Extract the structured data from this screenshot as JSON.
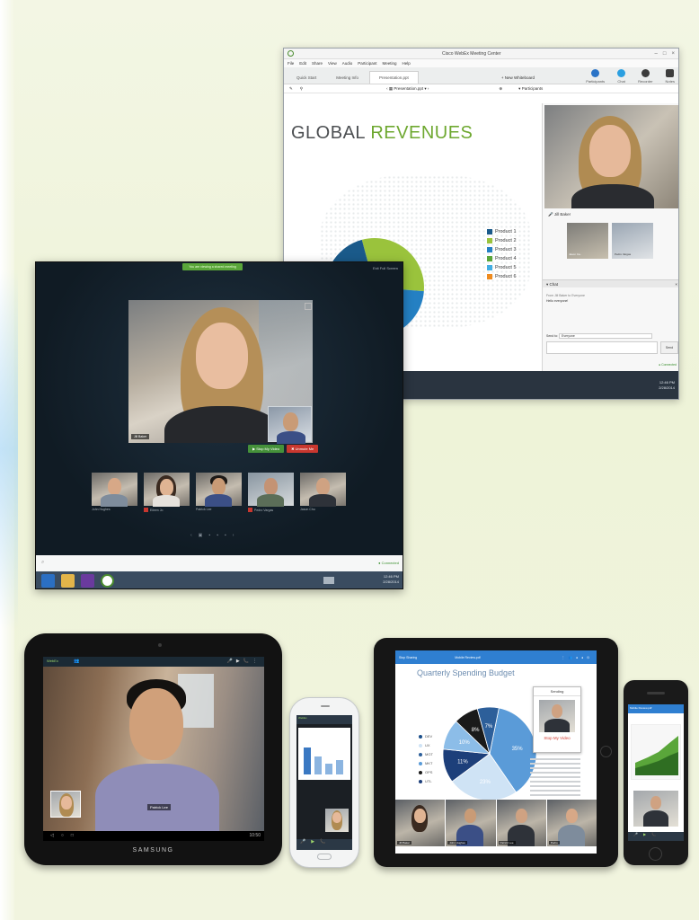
{
  "desktop_window_back": {
    "title": "Cisco WebEx Meeting Center",
    "menu": [
      "File",
      "Edit",
      "Share",
      "View",
      "Audio",
      "Participant",
      "Meeting",
      "Help"
    ],
    "tabs": [
      "Quick Start",
      "Meeting Info",
      "Presentation.ppt"
    ],
    "tools": [
      {
        "label": "Participants",
        "icon": "participants-icon",
        "color": "#2b74c7"
      },
      {
        "label": "Chat",
        "icon": "chat-icon",
        "color": "#2b9fe0"
      },
      {
        "label": "Recorder",
        "icon": "recorder-icon",
        "color": "#3c3c3c"
      },
      {
        "label": "Notes",
        "icon": "notes-icon",
        "color": "#3c3c3c"
      }
    ],
    "new_whiteboard": "New Whiteboard",
    "file_name": "Presentation.ppt",
    "slide_title_part1": "GLOBAL ",
    "slide_title_part2": "REVENUES",
    "legend": [
      {
        "label": "Product 1",
        "color": "#1a5a8a"
      },
      {
        "label": "Product 2",
        "color": "#9ac33c"
      },
      {
        "label": "Product 3",
        "color": "#2480c3"
      },
      {
        "label": "Product 4",
        "color": "#5aa63a"
      },
      {
        "label": "Product 5",
        "color": "#43aee3"
      },
      {
        "label": "Product 6",
        "color": "#ef8b1e"
      }
    ],
    "participants_header": "Participants",
    "speaker_name": "Jill Baker",
    "thumb_names": [
      "Jason Ca..",
      "Pedro Vargas"
    ],
    "chat_header": "Chat",
    "chat_from": "From Jill Baker to Everyone",
    "chat_msg": "Hello everyone!",
    "send_to_label": "Send to:",
    "send_to_value": "Everyone",
    "send_button": "Send",
    "connected": "Connected",
    "clock_time": "12:46 PM",
    "clock_date": "2/28/2014"
  },
  "desktop_window_front": {
    "top_pill": "You are viewing a shared meeting",
    "full_screen": "Exit Full Screen",
    "stage_name": "Jill Baker",
    "stop_video": "Stop My Video",
    "unmute": "Unmute Me",
    "thumbnails": [
      {
        "name": "John Hughes",
        "muted": false
      },
      {
        "name": "Eileen Jo",
        "muted": true
      },
      {
        "name": "Patrick Lee",
        "muted": false
      },
      {
        "name": "Pedro Vargas",
        "muted": true
      },
      {
        "name": "Jason Chu",
        "muted": false
      }
    ],
    "pager": [
      "‹",
      "▣",
      "▪",
      "▪",
      "▪",
      "›"
    ],
    "connected": "Connected",
    "clock_time": "12:46 PM",
    "clock_date": "2/28/2014"
  },
  "tablet": {
    "brand": "SAMSUNG",
    "caller_name": "Patrick Lee",
    "status_time": "10:50",
    "app_label": "WebEx"
  },
  "phone1": {
    "app_label": "WebEx"
  },
  "ipad": {
    "header_left": "Stop Sharing",
    "header_file": "Mobile Review.pdf",
    "title": "Quarterly Spending Budget",
    "legend": [
      {
        "label": "DEV",
        "color": "#1a4e8a"
      },
      {
        "label": "UX",
        "color": "#cfe3f5"
      },
      {
        "label": "MGT",
        "color": "#2d5f9a"
      },
      {
        "label": "MKT",
        "color": "#5a9bd8"
      },
      {
        "label": "OPS",
        "color": "#1a1a1a"
      },
      {
        "label": "UTL",
        "color": "#1d3f7a"
      }
    ],
    "pie": [
      {
        "label": "35%",
        "value": 35,
        "color": "#5a9bd8"
      },
      {
        "label": "23%",
        "value": 23,
        "color": "#cfe3f5"
      },
      {
        "label": "11%",
        "value": 11,
        "color": "#1d3f7a"
      },
      {
        "label": "10%",
        "value": 10,
        "color": "#8cbde8"
      },
      {
        "label": "8%",
        "value": 8,
        "color": "#1a1a1a"
      },
      {
        "label": "7%",
        "value": 7,
        "color": "#2d5f9a"
      }
    ],
    "sending_label": "Sending",
    "stop_my_video": "Stop My Video",
    "strip_names": [
      "Jill Baker",
      "John Hughes",
      "Patrick Lee",
      "Pedro"
    ]
  },
  "iphone": {
    "header": "Mobile Review.pdf"
  }
}
